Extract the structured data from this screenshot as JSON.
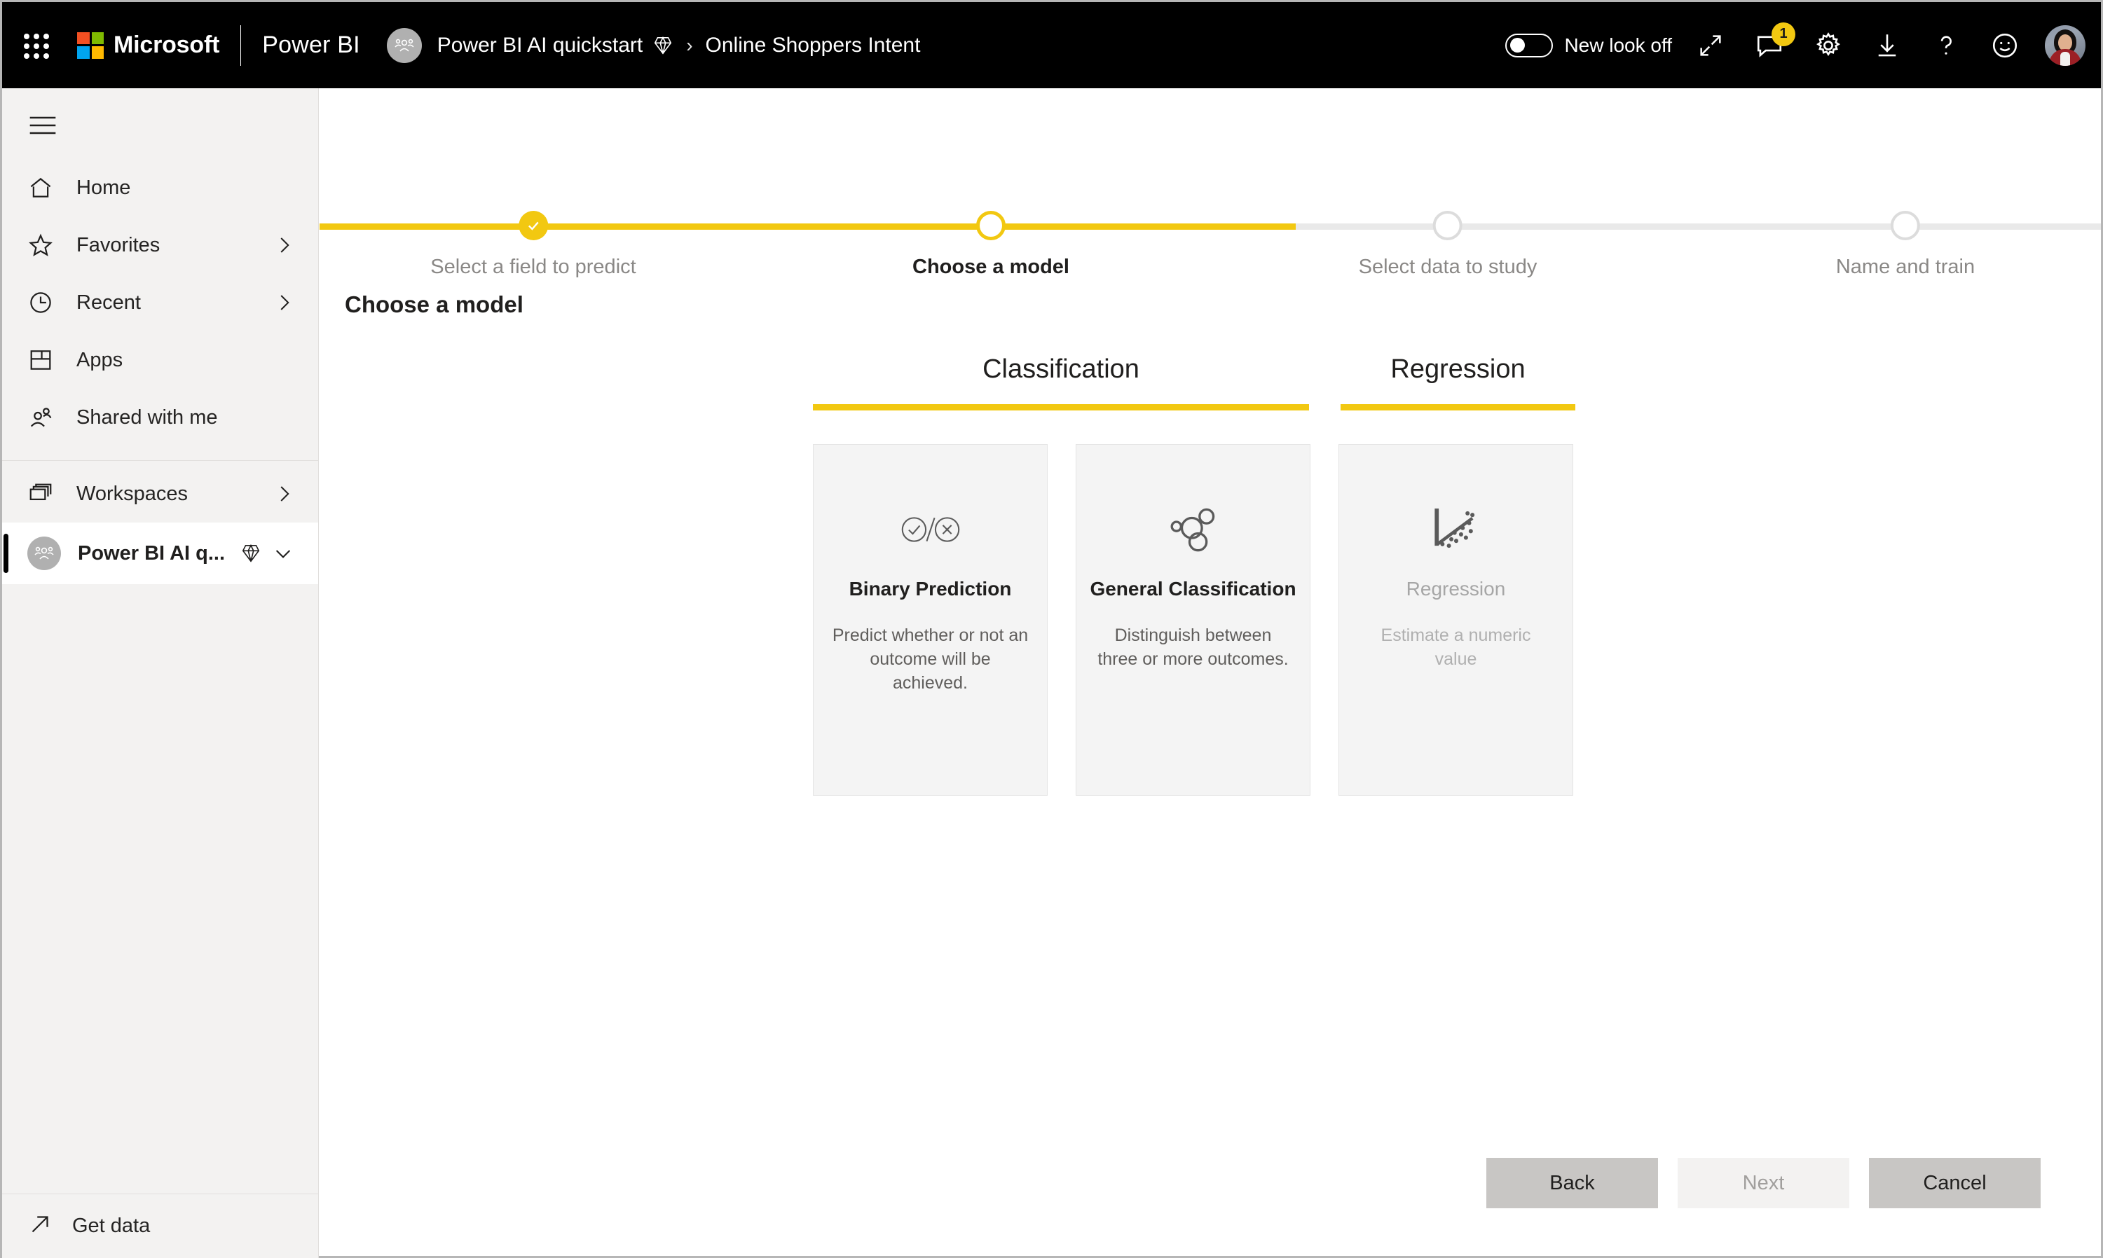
{
  "header": {
    "waffle_icon": "app-launcher-icon",
    "brand": "Microsoft",
    "product": "Power BI",
    "breadcrumb": {
      "workspace": "Power BI AI quickstart",
      "workspace_icon": "premium-diamond-icon",
      "separator": "›",
      "current": "Online Shoppers Intent"
    },
    "new_look_toggle": {
      "label": "New look off",
      "state": "off"
    },
    "icons": [
      {
        "name": "expand-icon",
        "glyph": "↗"
      },
      {
        "name": "feedback-comment-icon",
        "badge": "1"
      },
      {
        "name": "gear-icon"
      },
      {
        "name": "download-icon"
      },
      {
        "name": "help-icon",
        "glyph": "?"
      },
      {
        "name": "smiley-feedback-icon"
      }
    ],
    "avatar": "user-avatar"
  },
  "sidebar": {
    "hamburger_icon": "hamburger-menu-icon",
    "items": [
      {
        "label": "Home",
        "icon": "home-icon",
        "chevron": false
      },
      {
        "label": "Favorites",
        "icon": "star-icon",
        "chevron": true
      },
      {
        "label": "Recent",
        "icon": "clock-icon",
        "chevron": true
      },
      {
        "label": "Apps",
        "icon": "apps-icon",
        "chevron": false
      },
      {
        "label": "Shared with me",
        "icon": "people-icon",
        "chevron": false
      }
    ],
    "workspaces": {
      "label": "Workspaces",
      "icon": "workspaces-icon",
      "chevron": true
    },
    "active_workspace": {
      "label": "Power BI AI q...",
      "icon": "workspace-avatar-icon",
      "premium_icon": "premium-diamond-icon",
      "chevron": "chevron-down-icon"
    },
    "get_data": {
      "label": "Get data",
      "icon": "get-data-arrow-icon"
    }
  },
  "main": {
    "stepper": {
      "steps": [
        {
          "label": "Select a field to predict",
          "state": "done"
        },
        {
          "label": "Choose a model",
          "state": "current"
        },
        {
          "label": "Select data to study",
          "state": "todo"
        },
        {
          "label": "Name and train",
          "state": "todo"
        }
      ]
    },
    "page_title": "Choose a model",
    "tabs": [
      {
        "label": "Classification",
        "selected": true
      },
      {
        "label": "Regression",
        "selected": true
      }
    ],
    "cards": [
      {
        "title": "Binary Prediction",
        "description": "Predict whether or not an outcome will be achieved.",
        "icon": "binary-check-cross-icon",
        "enabled": true
      },
      {
        "title": "General Classification",
        "description": "Distinguish between three or more outcomes.",
        "icon": "bubbles-cluster-icon",
        "enabled": true
      },
      {
        "title": "Regression",
        "description": "Estimate a numeric value",
        "icon": "scatter-plot-trend-icon",
        "enabled": false
      }
    ],
    "footer_buttons": [
      {
        "label": "Back",
        "state": "enabled"
      },
      {
        "label": "Next",
        "state": "disabled"
      },
      {
        "label": "Cancel",
        "state": "enabled"
      }
    ]
  },
  "colors": {
    "accent_yellow": "#f2c811",
    "header_black": "#000000",
    "sidebar_gray": "#f3f2f1",
    "card_gray": "#f4f4f4",
    "button_gray": "#c8c6c4"
  }
}
